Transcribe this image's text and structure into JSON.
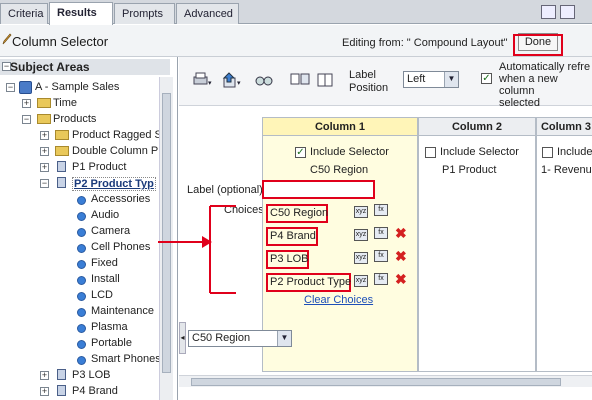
{
  "tabs": [
    "Criteria",
    "Results",
    "Prompts",
    "Advanced"
  ],
  "active_tab": "Results",
  "title": "Column Selector",
  "editing_from": "Editing from: \" Compound Layout\"",
  "done_label": "Done",
  "left_pane": {
    "header": "Subject Areas",
    "items": [
      {
        "label": "A - Sample Sales",
        "icon": "cube-icon"
      },
      {
        "label": "Time",
        "icon": "folder-icon"
      },
      {
        "label": "Products",
        "icon": "folder-icon"
      },
      {
        "label": "Product Ragged S",
        "icon": "folder-icon"
      },
      {
        "label": "Double Column Pr",
        "icon": "folder-icon"
      },
      {
        "label": "P1 Product",
        "icon": "table-icon"
      },
      {
        "label": "P2 Product Typ",
        "icon": "table-icon"
      },
      {
        "label": "Accessories",
        "icon": "column-icon"
      },
      {
        "label": "Audio",
        "icon": "column-icon"
      },
      {
        "label": "Camera",
        "icon": "column-icon"
      },
      {
        "label": "Cell Phones",
        "icon": "column-icon"
      },
      {
        "label": "Fixed",
        "icon": "column-icon"
      },
      {
        "label": "Install",
        "icon": "column-icon"
      },
      {
        "label": "LCD",
        "icon": "column-icon"
      },
      {
        "label": "Maintenance",
        "icon": "column-icon"
      },
      {
        "label": "Plasma",
        "icon": "column-icon"
      },
      {
        "label": "Portable",
        "icon": "column-icon"
      },
      {
        "label": "Smart Phones",
        "icon": "column-icon"
      },
      {
        "label": "P3 LOB",
        "icon": "table-icon"
      },
      {
        "label": "P4 Brand",
        "icon": "table-icon"
      }
    ]
  },
  "toolbar": {
    "label_position_label": "Label\nPosition",
    "label_position_value": "Left",
    "auto_refresh_text": "Automatically refre\nwhen a new column\nselected"
  },
  "label_optional": "Label (optional)",
  "choices_label": "Choices",
  "columns": [
    {
      "header": "Column 1",
      "include_label": "Include Selector",
      "value": "C50 Region"
    },
    {
      "header": "Column 2",
      "include_label": "Include Selector",
      "value": "P1 Product"
    },
    {
      "header": "Column 3",
      "include_label": "Include Selecto",
      "value": "1- Revenue"
    }
  ],
  "choices": [
    "C50 Region",
    "P4 Brand",
    "P3 LOB",
    "P2 Product Type"
  ],
  "clear_choices": "Clear Choices",
  "preview_dropdown_value": "C50 Region"
}
